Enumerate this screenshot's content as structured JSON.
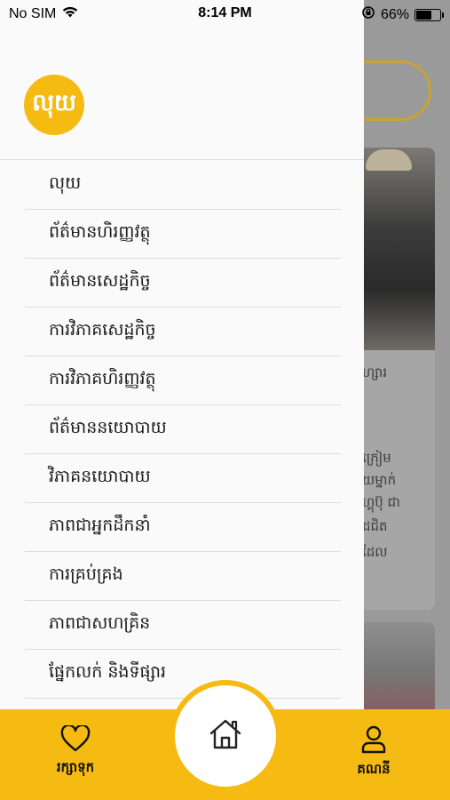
{
  "status_bar": {
    "carrier": "No SIM",
    "time": "8:14 PM",
    "battery": "66%",
    "battery_level": 0.66
  },
  "drawer": {
    "logo_text": "លុយ",
    "menu": [
      {
        "label": "លុយ"
      },
      {
        "label": "ព័ត៌មានហិរញ្ញវត្ថុ"
      },
      {
        "label": "ព័ត៌មានសេដ្ឋកិច្ច"
      },
      {
        "label": "ការវិភាគសេដ្ឋកិច្ច"
      },
      {
        "label": "ការវិភាគហិរញ្ញវត្ថុ"
      },
      {
        "label": "ព័ត៌មាននយោបាយ"
      },
      {
        "label": "វិភាគនយោបាយ"
      },
      {
        "label": "ភាពជាអ្នកដឹកនាំ"
      },
      {
        "label": "ការគ្រប់គ្រង"
      },
      {
        "label": "ភាពជាសហគ្រិន"
      },
      {
        "label": "ផ្នែកលក់ និងទីផ្សារ"
      }
    ]
  },
  "background": {
    "text_lines": [
      "ហ្សារ",
      "ក្រៀម",
      "យម្នាក់",
      "ហ្គុប៊ុ ជា",
      "ដជិត",
      "ដែល"
    ]
  },
  "tabbar": {
    "save_label": "រក្សាទុក",
    "account_label": "គណនី"
  },
  "colors": {
    "accent": "#f6bb12",
    "drawer_bg": "#fafafa",
    "overlay_bg": "#9a9a9a"
  },
  "icons": {
    "status": [
      "wifi-icon",
      "orientation-lock-icon",
      "battery-icon"
    ],
    "tabs": [
      "heart-icon",
      "home-icon",
      "user-icon"
    ]
  }
}
